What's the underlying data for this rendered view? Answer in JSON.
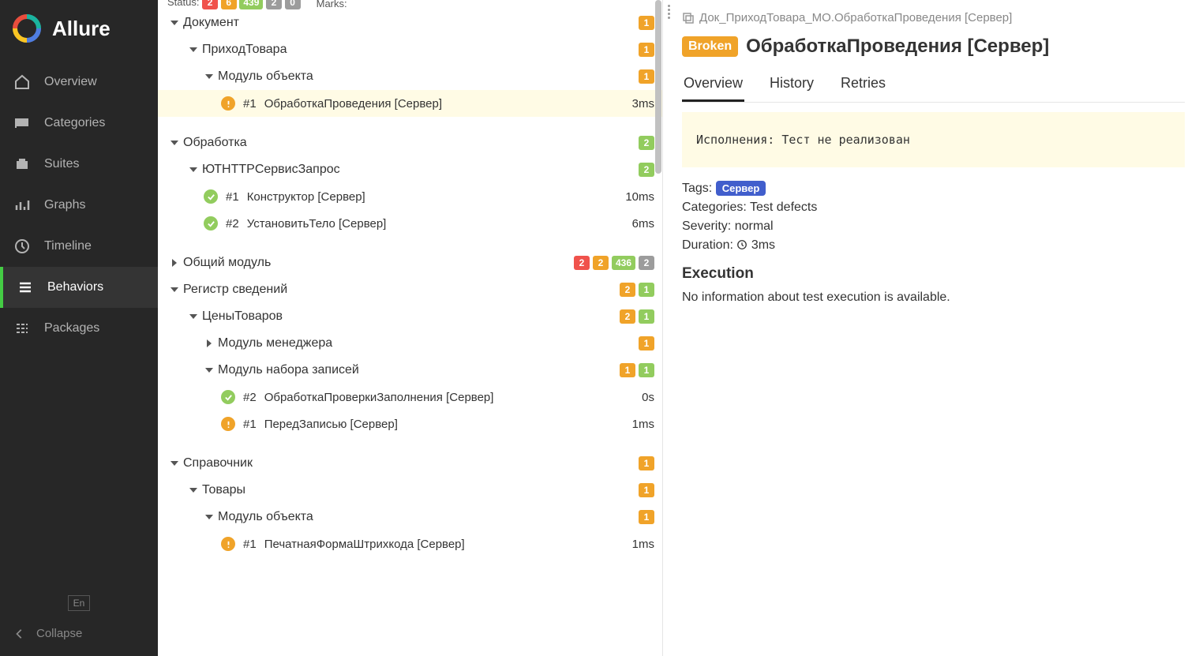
{
  "brand": "Allure",
  "nav": [
    {
      "id": "overview",
      "label": "Overview"
    },
    {
      "id": "categories",
      "label": "Categories"
    },
    {
      "id": "suites",
      "label": "Suites"
    },
    {
      "id": "graphs",
      "label": "Graphs"
    },
    {
      "id": "timeline",
      "label": "Timeline"
    },
    {
      "id": "behaviors",
      "label": "Behaviors"
    },
    {
      "id": "packages",
      "label": "Packages"
    }
  ],
  "lang": "En",
  "collapse": "Collapse",
  "topbar": {
    "status_label": "Status:",
    "status_pills": [
      "2",
      "6",
      "439",
      "2",
      "0"
    ],
    "marks_label": "Marks:"
  },
  "tree": [
    {
      "type": "group",
      "depth": 1,
      "open": true,
      "label": "Документ",
      "pills": [
        {
          "c": "orange",
          "v": "1"
        }
      ]
    },
    {
      "type": "group",
      "depth": 2,
      "open": true,
      "label": "ПриходТовара",
      "pills": [
        {
          "c": "orange",
          "v": "1"
        }
      ]
    },
    {
      "type": "group",
      "depth": 3,
      "open": true,
      "label": "Модуль объекта",
      "pills": [
        {
          "c": "orange",
          "v": "1"
        }
      ]
    },
    {
      "type": "leaf",
      "depth": 4,
      "status": "broken",
      "num": "#1",
      "label": "ОбработкаПроведения [Сервер]",
      "time": "3ms",
      "selected": true
    },
    {
      "type": "spacer"
    },
    {
      "type": "group",
      "depth": 1,
      "open": true,
      "label": "Обработка",
      "pills": [
        {
          "c": "green",
          "v": "2"
        }
      ]
    },
    {
      "type": "group",
      "depth": 2,
      "open": true,
      "label": "ЮТHTTPСервисЗапрос",
      "pills": [
        {
          "c": "green",
          "v": "2"
        }
      ]
    },
    {
      "type": "leaf",
      "depth": 3,
      "status": "pass",
      "num": "#1",
      "label": "Конструктор [Сервер]",
      "time": "10ms"
    },
    {
      "type": "leaf",
      "depth": 3,
      "status": "pass",
      "num": "#2",
      "label": "УстановитьТело [Сервер]",
      "time": "6ms"
    },
    {
      "type": "spacer"
    },
    {
      "type": "group",
      "depth": 1,
      "open": false,
      "label": "Общий модуль",
      "pills": [
        {
          "c": "red",
          "v": "2"
        },
        {
          "c": "orange",
          "v": "2"
        },
        {
          "c": "green",
          "v": "436"
        },
        {
          "c": "grey",
          "v": "2"
        }
      ]
    },
    {
      "type": "group",
      "depth": 1,
      "open": true,
      "label": "Регистр сведений",
      "pills": [
        {
          "c": "orange",
          "v": "2"
        },
        {
          "c": "green",
          "v": "1"
        }
      ]
    },
    {
      "type": "group",
      "depth": 2,
      "open": true,
      "label": "ЦеныТоваров",
      "pills": [
        {
          "c": "orange",
          "v": "2"
        },
        {
          "c": "green",
          "v": "1"
        }
      ]
    },
    {
      "type": "group",
      "depth": 3,
      "open": false,
      "label": "Модуль менеджера",
      "pills": [
        {
          "c": "orange",
          "v": "1"
        }
      ]
    },
    {
      "type": "group",
      "depth": 3,
      "open": true,
      "label": "Модуль набора записей",
      "pills": [
        {
          "c": "orange",
          "v": "1"
        },
        {
          "c": "green",
          "v": "1"
        }
      ]
    },
    {
      "type": "leaf",
      "depth": 4,
      "status": "pass",
      "num": "#2",
      "label": "ОбработкаПроверкиЗаполнения [Сервер]",
      "time": "0s"
    },
    {
      "type": "leaf",
      "depth": 4,
      "status": "broken",
      "num": "#1",
      "label": "ПередЗаписью [Сервер]",
      "time": "1ms"
    },
    {
      "type": "spacer"
    },
    {
      "type": "group",
      "depth": 1,
      "open": true,
      "label": "Справочник",
      "pills": [
        {
          "c": "orange",
          "v": "1"
        }
      ]
    },
    {
      "type": "group",
      "depth": 2,
      "open": true,
      "label": "Товары",
      "pills": [
        {
          "c": "orange",
          "v": "1"
        }
      ]
    },
    {
      "type": "group",
      "depth": 3,
      "open": true,
      "label": "Модуль объекта",
      "pills": [
        {
          "c": "orange",
          "v": "1"
        }
      ]
    },
    {
      "type": "leaf",
      "depth": 4,
      "status": "broken",
      "num": "#1",
      "label": "ПечатнаяФормаШтрихкода [Сервер]",
      "time": "1ms"
    }
  ],
  "detail": {
    "crumb": "Док_ПриходТовара_МО.ОбработкаПроведения [Сервер]",
    "status_badge": "Broken",
    "title": "ОбработкаПроведения [Сервер]",
    "tabs": {
      "overview": "Overview",
      "history": "History",
      "retries": "Retries"
    },
    "message": "Исполнения: Тест не реализован",
    "tags_label": "Tags:",
    "tags": [
      "Сервер"
    ],
    "categories_label": "Categories:",
    "categories_value": "Test defects",
    "severity_label": "Severity:",
    "severity_value": "normal",
    "duration_label": "Duration:",
    "duration_value": "3ms",
    "execution_heading": "Execution",
    "execution_body": "No information about test execution is available."
  }
}
